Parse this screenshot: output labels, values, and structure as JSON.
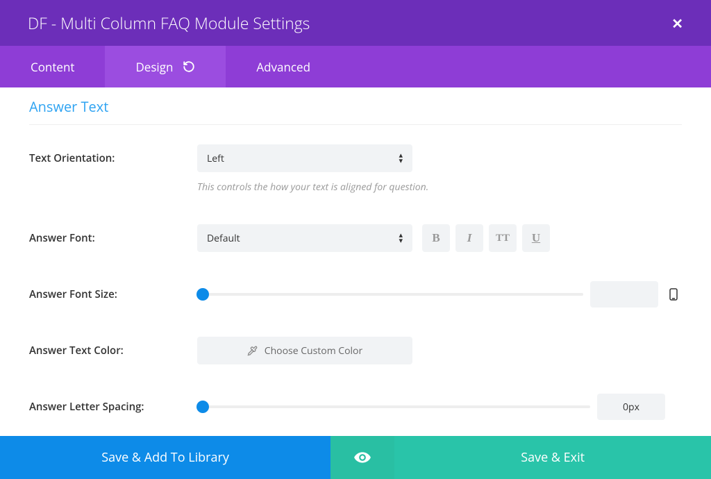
{
  "header": {
    "title": "DF - Multi Column FAQ Module Settings"
  },
  "tabs": {
    "content": "Content",
    "design": "Design",
    "advanced": "Advanced",
    "active": "design"
  },
  "section": {
    "title": "Answer Text"
  },
  "fields": {
    "textOrientation": {
      "label": "Text Orientation:",
      "value": "Left",
      "help": "This controls the how your text is aligned for question."
    },
    "answerFont": {
      "label": "Answer Font:",
      "value": "Default"
    },
    "answerFontSize": {
      "label": "Answer Font Size:",
      "value": ""
    },
    "answerTextColor": {
      "label": "Answer Text Color:",
      "button": "Choose Custom Color"
    },
    "answerLetterSpacing": {
      "label": "Answer Letter Spacing:",
      "value": "0px"
    }
  },
  "styleButtons": {
    "bold": "B",
    "italic": "I",
    "smallcaps": "TT",
    "underline": "U"
  },
  "footer": {
    "library": "Save & Add To Library",
    "save": "Save & Exit"
  }
}
